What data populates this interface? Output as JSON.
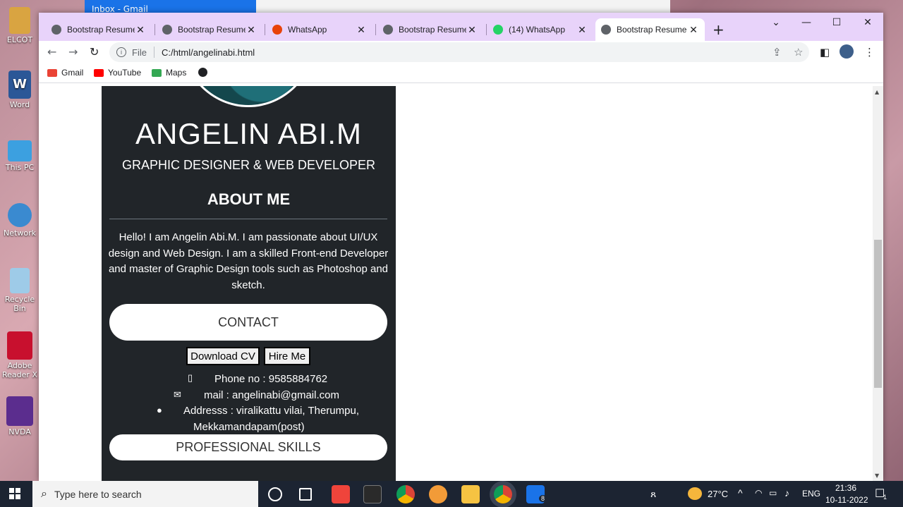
{
  "desktop": {
    "icons": [
      {
        "label": "ELCOT",
        "color": "#d9a441"
      },
      {
        "label": "Word",
        "color": "#2b5797"
      },
      {
        "label": "This PC",
        "color": "#3ca0e0"
      },
      {
        "label": "Network",
        "color": "#3a8ad0"
      },
      {
        "label": "Recycle Bin",
        "color": "#9ecbe8"
      },
      {
        "label": "Adobe Reader X",
        "color": "#c8102e"
      },
      {
        "label": "NVDA",
        "color": "#5b2d8e"
      }
    ],
    "background_window_tab": "Inbox - Gmail"
  },
  "browser": {
    "tabs": [
      {
        "title": "Bootstrap Resume",
        "favicon": "globe-icon"
      },
      {
        "title": "Bootstrap Resume",
        "favicon": "globe-icon"
      },
      {
        "title": "WhatsApp",
        "favicon": "alert-icon"
      },
      {
        "title": "Bootstrap Resume",
        "favicon": "globe-icon"
      },
      {
        "title": "(14) WhatsApp",
        "favicon": "whatsapp-icon"
      },
      {
        "title": "Bootstrap Resume",
        "favicon": "globe-icon",
        "active": true
      }
    ],
    "new_tab_symbol": "+",
    "address": {
      "scheme_label": "File",
      "url": "C:/html/angelinabi.html"
    },
    "bookmarks": [
      {
        "label": "Gmail",
        "color": "#ea4335"
      },
      {
        "label": "YouTube",
        "color": "#ff0000"
      },
      {
        "label": "Maps",
        "color": "#34a853"
      }
    ]
  },
  "resume": {
    "name": "ANGELIN ABI.M",
    "role": "GRAPHIC DESIGNER & WEB DEVELOPER",
    "about_heading": "ABOUT ME",
    "about_text": "Hello! I am Angelin Abi.M. I am passionate about UI/UX design and Web Design. I am a skilled Front-end Developer and master of Graphic Design tools such as Photoshop and sketch.",
    "contact_label": "CONTACT",
    "download_cv_label": "Download CV",
    "hire_me_label": "Hire Me",
    "phone": "Phone no : 9585884762",
    "mail": "mail : angelinabi@gmail.com",
    "address_line1": "Addresss : viralikattu vilai, Therumpu,",
    "address_line2": "Mekkamandapam(post)",
    "skills_label": "PROFESSIONAL SKILLS"
  },
  "taskbar": {
    "search_placeholder": "Type here to search",
    "weather": "27°C",
    "language": "ENG",
    "time": "21:36",
    "date": "10-11-2022",
    "mail_badge": "8",
    "notification_badge": "1"
  }
}
